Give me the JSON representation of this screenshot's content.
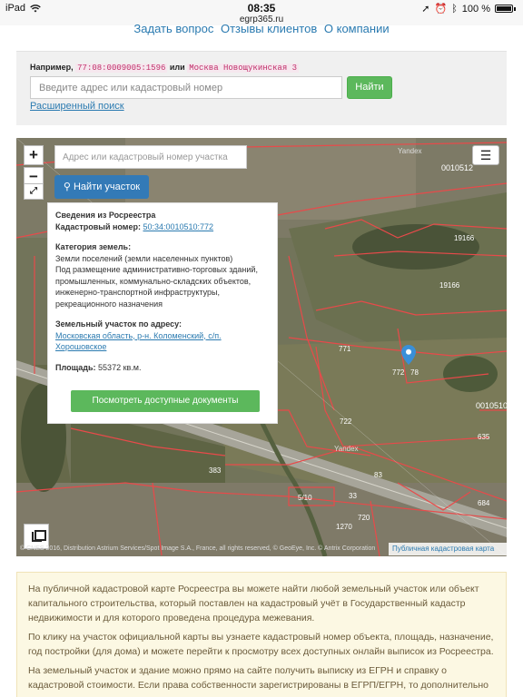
{
  "status_bar": {
    "device": "iPad",
    "time": "08:35",
    "battery": "100 %",
    "url": "egrp365.ru"
  },
  "topnav": {
    "items": [
      "Задать вопрос",
      "Отзывы клиентов",
      "О компании"
    ]
  },
  "search": {
    "example_prefix": "Например,",
    "example_code": "77:08:0009005:1596",
    "example_or": "или",
    "example_address": "Москва Новощукинская 3",
    "placeholder": "Введите адрес или кадастровый номер",
    "button": "Найти",
    "advanced_link": "Расширенный поиск"
  },
  "map": {
    "zoom_in": "+",
    "zoom_out": "−",
    "search_placeholder": "Адрес или кадастровый номер участка",
    "find_button": "Найти участок",
    "menu_icon": "hamburger-icon",
    "attribution": "© CNES 2016, Distribution Astrium Services/Spot Image S.A., France, all rights reserved, © GeoEye, Inc. © Antrix Corporation",
    "pkk_label": "Публичная кадастровая карта",
    "plot_labels": [
      "0010512",
      "19166",
      "19166",
      "771",
      "772",
      "78",
      "722",
      "0010510",
      "635",
      "83",
      "383",
      "684",
      "5/10",
      "33",
      "1270",
      "720",
      "Yandex",
      "Yandex"
    ],
    "popup": {
      "title": "Сведения из Росреестра",
      "cadastral_label": "Кадастровый номер:",
      "cadastral_value": "50:34:0010510:772",
      "category_label": "Категория земель:",
      "category_line1": "Земли поселений (земли населенных пунктов)",
      "category_line2": "Под размещение административно-торговых зданий, промышленных, коммунально-складских объектов, инженерно-транспортной инфраструктуры, рекреационного назначения",
      "address_label": "Земельный участок по адресу:",
      "address_value": "Московская область, р-н. Коломенский, с/п. Хорошовское",
      "area_label": "Площадь:",
      "area_value": "55372 кв.м.",
      "docs_button": "Посмотреть доступные документы"
    }
  },
  "info": {
    "paragraphs": [
      "На публичной кадастровой карте Росреестра вы можете найти любой земельный участок или объект капитального строительства, который поставлен на кадастровый учёт в Государственный кадастр недвижимости и для которого проведена процедура межевания.",
      "По клику на участок официальной карты вы узнаете кадастровый номер объекта, площадь, назначение, год постройки (для дома) и можете перейти к просмотру всех доступных онлайн выписок из Росреестра.",
      "На земельный участок и здание можно прямо на сайте получить выписку из ЕГРН и справку о кадастровой стоимости. Если права собственности зарегистрированы в ЕГРП/ЕГРН, то дополнительно"
    ]
  }
}
